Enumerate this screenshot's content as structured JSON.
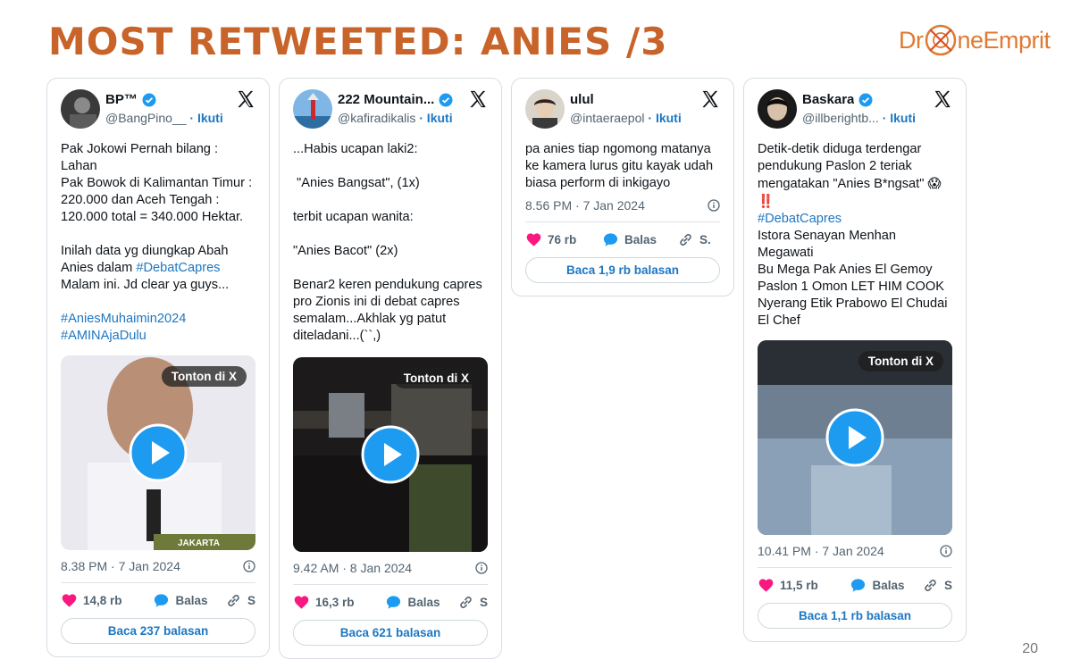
{
  "slide": {
    "title": "MOST RETWEETED: ANIES /3",
    "logo_left": "Dr",
    "logo_right": "neEmprit",
    "page_number": "20"
  },
  "colors": {
    "title": "#c8632a",
    "link": "#1d77c2",
    "verified": "#1d9bf0",
    "like": "#f91880",
    "reply": "#1d9bf0"
  },
  "cards": [
    {
      "name": "BP™",
      "handle": "@BangPino__",
      "follow": "· Ikuti",
      "body": [
        "Pak Jokowi Pernah bilang : Lahan",
        "Pak Bowok di Kalimantan Timur :",
        "220.000 dan Aceh Tengah :",
        "120.000 total = 340.000 Hektar.",
        "",
        "Inilah data yg diungkap Abah",
        "Anies dalam",
        "#DebatCapres",
        "Malam ini. Jd clear ya guys...",
        "",
        "#AniesMuhaimin2024",
        "#AMINAjaDulu"
      ],
      "watch_label": "Tonton di X",
      "media_caption": "JAKARTA",
      "timestamp": "8.38 PM · 7 Jan 2024",
      "likes": "14,8 rb",
      "reply_label": "Balas",
      "share_label": "S",
      "read_replies": "Baca 237 balasan"
    },
    {
      "name": "222 Mountain...",
      "handle": "@kafiradikalis",
      "follow": "· Ikuti",
      "body": [
        "...Habis ucapan laki2:",
        "",
        " \"Anies Bangsat\", (1x)",
        "",
        "terbit ucapan wanita:",
        "",
        "\"Anies Bacot\" (2x)",
        "",
        "Benar2 keren pendukung capres",
        "pro Zionis ini di debat capres",
        "semalam...Akhlak yg patut",
        "diteladani...(``,)"
      ],
      "watch_label": "Tonton di X",
      "timestamp": "9.42 AM · 8 Jan 2024",
      "likes": "16,3 rb",
      "reply_label": "Balas",
      "share_label": "S",
      "read_replies": "Baca 621 balasan"
    },
    {
      "name": "ulul",
      "handle": "@intaeraepol",
      "follow": "· Ikuti",
      "body": [
        "pa anies tiap ngomong matanya",
        "ke kamera lurus gitu kayak udah",
        "biasa perform di inkigayo"
      ],
      "timestamp": "8.56 PM · 7 Jan 2024",
      "likes": "76 rb",
      "reply_label": "Balas",
      "share_label": "S.",
      "read_replies": "Baca 1,9 rb balasan"
    },
    {
      "name": "Baskara",
      "handle": "@illberightb...",
      "follow": "· Ikuti",
      "body": [
        "Detik-detik diduga terdengar",
        "pendukung Paslon 2 teriak",
        "mengatakan \"Anies B*ngsat\"",
        "",
        "#DebatCapres",
        "Istora Senayan Menhan Megawati",
        "Bu Mega Pak Anies El Gemoy",
        "Paslon 1 Omon LET HIM COOK",
        "Nyerang Etik Prabowo El Chudai",
        "El Chef"
      ],
      "emoji_scream": "😱",
      "emoji_bang": "‼️",
      "watch_label": "Tonton di X",
      "timestamp": "10.41 PM · 7 Jan 2024",
      "likes": "11,5 rb",
      "reply_label": "Balas",
      "share_label": "S",
      "read_replies": "Baca 1,1 rb balasan"
    }
  ]
}
